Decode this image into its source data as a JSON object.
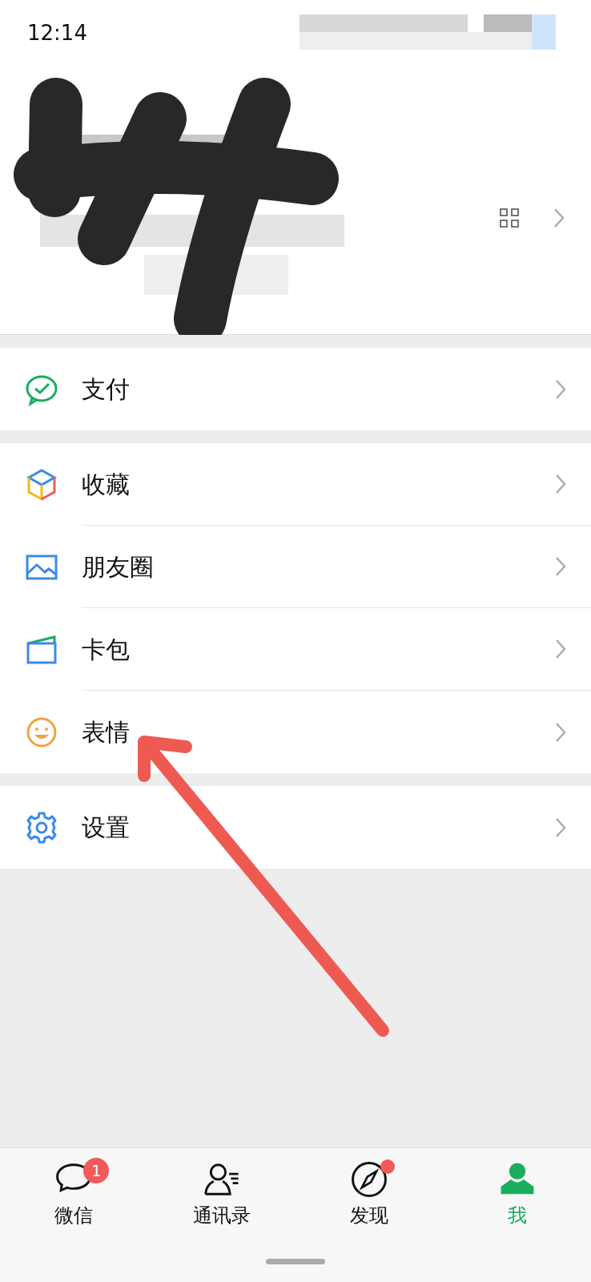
{
  "status_bar": {
    "time": "12:14"
  },
  "groups": [
    {
      "items": [
        {
          "label": "支付",
          "kind": "pay"
        }
      ]
    },
    {
      "items": [
        {
          "label": "收藏",
          "kind": "favorites"
        },
        {
          "label": "朋友圈",
          "kind": "moments"
        },
        {
          "label": "卡包",
          "kind": "cards"
        },
        {
          "label": "表情",
          "kind": "stickers"
        }
      ]
    },
    {
      "items": [
        {
          "label": "设置",
          "kind": "settings"
        }
      ]
    }
  ],
  "tabs": [
    {
      "label": "微信",
      "kind": "chat",
      "selected": false,
      "badge": "1"
    },
    {
      "label": "通讯录",
      "kind": "contacts",
      "selected": false
    },
    {
      "label": "发现",
      "kind": "discover",
      "selected": false,
      "dot": true
    },
    {
      "label": "我",
      "kind": "me",
      "selected": true
    }
  ]
}
